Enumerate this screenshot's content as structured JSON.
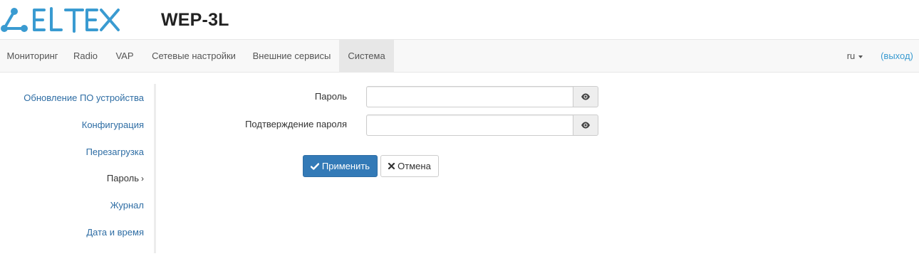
{
  "header": {
    "logo_text": "ELTEX",
    "product_title": "WEP-3L"
  },
  "navbar": {
    "items": [
      {
        "label": "Мониторинг"
      },
      {
        "label": "Radio"
      },
      {
        "label": "VAP"
      },
      {
        "label": "Сетевые настройки"
      },
      {
        "label": "Внешние сервисы"
      },
      {
        "label": "Система",
        "active": true
      }
    ],
    "language": "ru",
    "logout": "(выход)"
  },
  "sidebar": {
    "items": [
      {
        "label": "Обновление ПО устройства"
      },
      {
        "label": "Конфигурация"
      },
      {
        "label": "Перезагрузка"
      },
      {
        "label": "Пароль",
        "active": true,
        "chevron": "›"
      },
      {
        "label": "Журнал"
      },
      {
        "label": "Дата и время"
      }
    ]
  },
  "form": {
    "password_label": "Пароль",
    "password_value": "",
    "confirm_label": "Подтверждение пароля",
    "confirm_value": "",
    "show_icon": "eye-icon"
  },
  "actions": {
    "apply_label": "Применить",
    "apply_icon": "check-icon",
    "cancel_label": "Отмена",
    "cancel_icon": "times-icon"
  },
  "colors": {
    "brand": "#3a9bd1",
    "primary": "#337ab7",
    "link": "#2e6da4",
    "nav_bg": "#f8f8f8",
    "nav_active_bg": "#e7e7e7"
  }
}
